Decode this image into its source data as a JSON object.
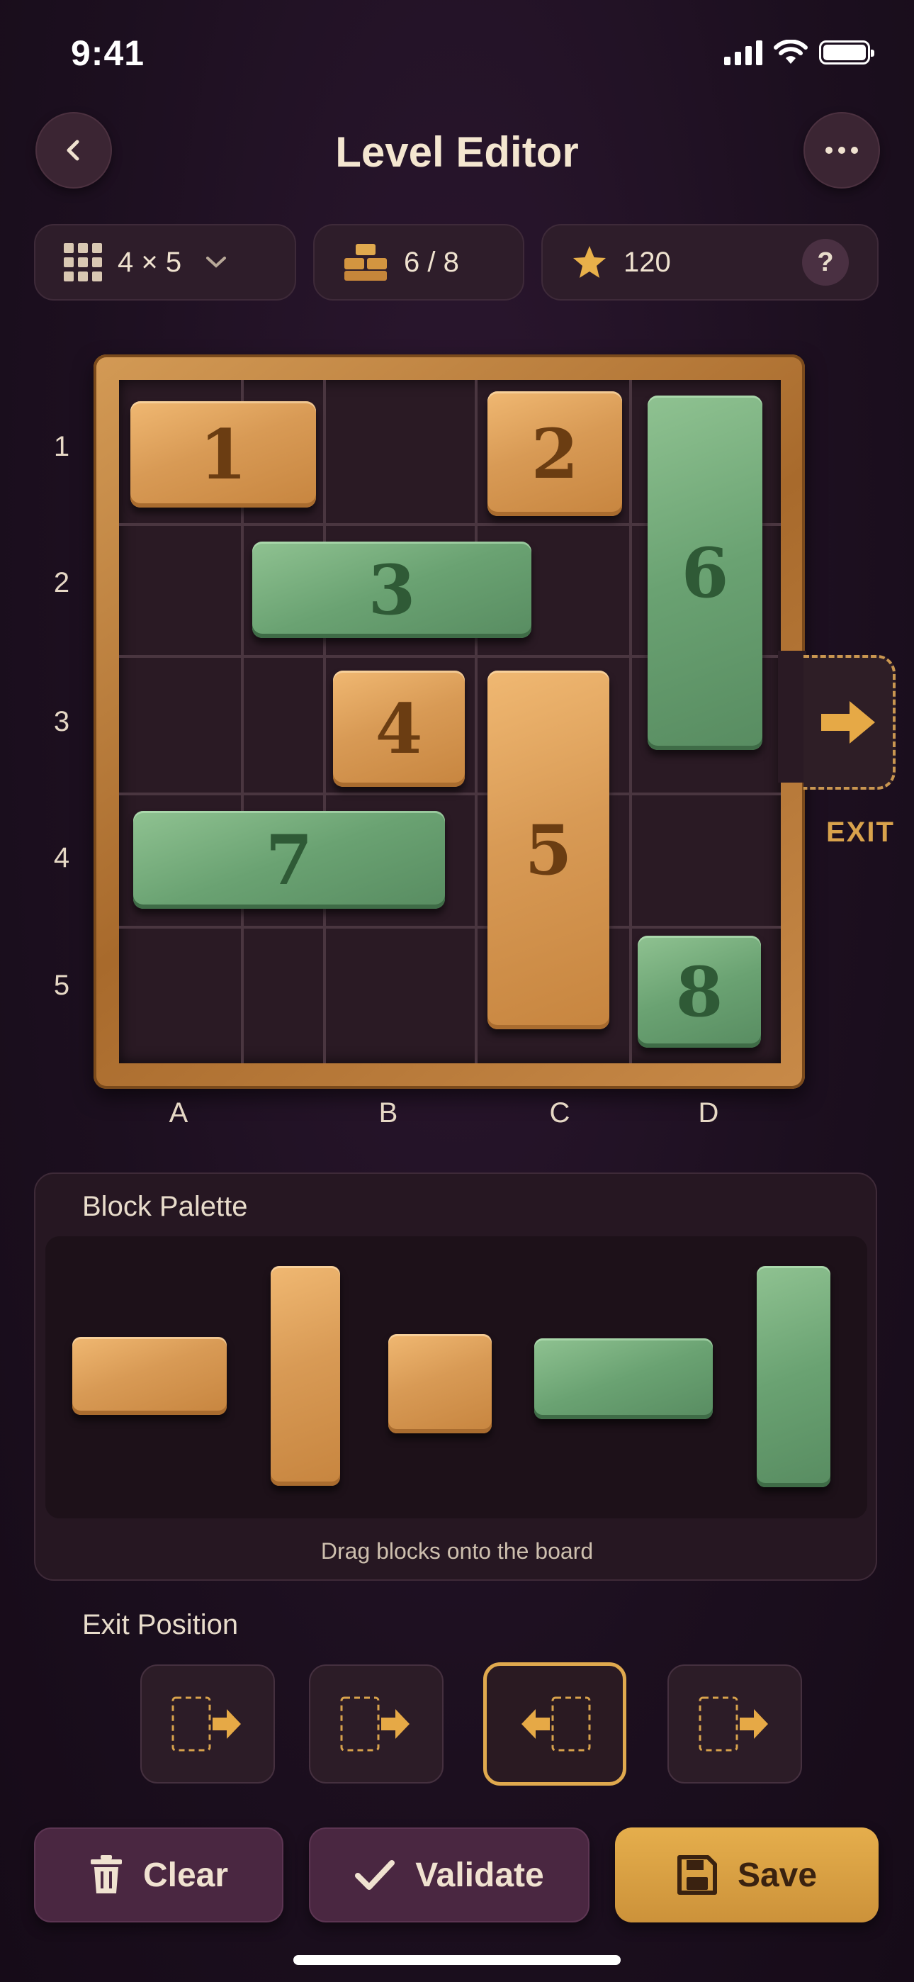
{
  "status": {
    "time": "9:41"
  },
  "header": {
    "title": "Level Editor"
  },
  "stats": {
    "grid_size": "4 × 5",
    "blocks_count": "6 / 8",
    "score": "120",
    "help": "?"
  },
  "board": {
    "rows": [
      "1",
      "2",
      "3",
      "4",
      "5"
    ],
    "columns": [
      "A",
      "B",
      "C",
      "D"
    ],
    "exit_label": "EXIT",
    "blocks": [
      {
        "label": "1",
        "material": "wood"
      },
      {
        "label": "2",
        "material": "wood"
      },
      {
        "label": "3",
        "material": "stone"
      },
      {
        "label": "4",
        "material": "wood"
      },
      {
        "label": "5",
        "material": "wood"
      },
      {
        "label": "6",
        "material": "stone"
      },
      {
        "label": "7",
        "material": "stone"
      },
      {
        "label": "8",
        "material": "stone"
      }
    ]
  },
  "palette": {
    "title": "Block Palette",
    "hint": "Drag blocks onto the board",
    "items": [
      "wood-horizontal-2",
      "wood-vertical-3",
      "wood-square-1",
      "stone-horizontal-2",
      "stone-vertical-3"
    ]
  },
  "exit_position": {
    "title": "Exit Position",
    "options": [
      "right",
      "right",
      "left",
      "right"
    ],
    "selected_index": 2
  },
  "actions": {
    "clear": "Clear",
    "validate": "Validate",
    "save": "Save"
  },
  "colors": {
    "accent_gold": "#e0a94e",
    "wood": "#d89a55",
    "stone": "#6aa272",
    "background": "#1c0f1f"
  }
}
